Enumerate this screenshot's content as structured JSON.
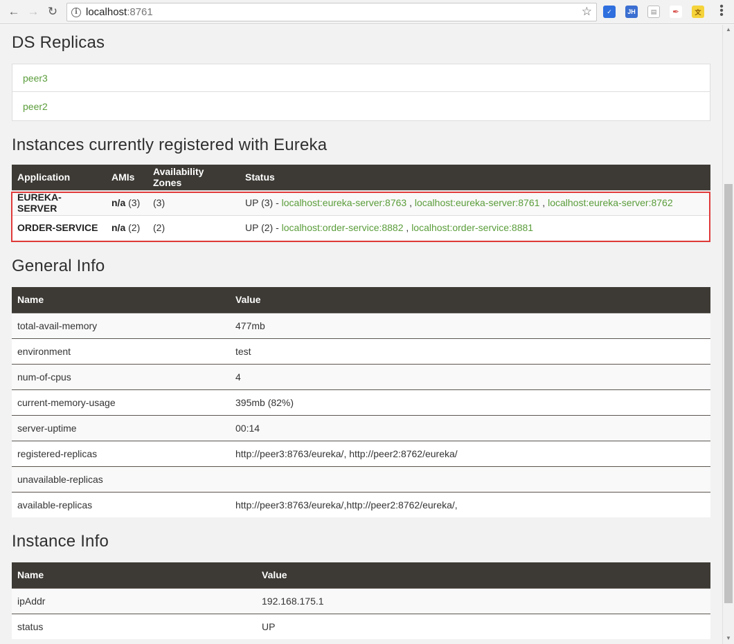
{
  "browser": {
    "url_host": "localhost",
    "url_port": ":8761",
    "extensions": [
      {
        "name": "pocket-icon",
        "label": "",
        "color": "#2f6fde"
      },
      {
        "name": "jh-icon",
        "label": "JH",
        "color": "#3b6fd1"
      },
      {
        "name": "page-icon",
        "label": "",
        "color": "#b0b0b0"
      },
      {
        "name": "pen-icon",
        "label": "",
        "color": "#d9534f"
      },
      {
        "name": "translate-icon",
        "label": "",
        "color": "#e6b800"
      }
    ]
  },
  "ds_replicas": {
    "title": "DS Replicas",
    "items": [
      "peer3",
      "peer2"
    ]
  },
  "instances": {
    "title": "Instances currently registered with Eureka",
    "headers": [
      "Application",
      "AMIs",
      "Availability Zones",
      "Status"
    ],
    "rows": [
      {
        "application": "EUREKA-SERVER",
        "amis_bold": "n/a",
        "amis_count": " (3)",
        "zones": "(3)",
        "status_prefix": "UP (3) - ",
        "links": [
          "localhost:eureka-server:8763",
          "localhost:eureka-server:8761",
          "localhost:eureka-server:8762"
        ]
      },
      {
        "application": "ORDER-SERVICE",
        "amis_bold": "n/a",
        "amis_count": " (2)",
        "zones": "(2)",
        "status_prefix": "UP (2) - ",
        "links": [
          "localhost:order-service:8882",
          "localhost:order-service:8881"
        ]
      }
    ]
  },
  "general_info": {
    "title": "General Info",
    "headers": [
      "Name",
      "Value"
    ],
    "rows": [
      {
        "name": "total-avail-memory",
        "value": "477mb"
      },
      {
        "name": "environment",
        "value": "test"
      },
      {
        "name": "num-of-cpus",
        "value": "4"
      },
      {
        "name": "current-memory-usage",
        "value": "395mb (82%)"
      },
      {
        "name": "server-uptime",
        "value": "00:14"
      },
      {
        "name": "registered-replicas",
        "value": "http://peer3:8763/eureka/, http://peer2:8762/eureka/"
      },
      {
        "name": "unavailable-replicas",
        "value": ""
      },
      {
        "name": "available-replicas",
        "value": "http://peer3:8763/eureka/,http://peer2:8762/eureka/,"
      }
    ]
  },
  "instance_info": {
    "title": "Instance Info",
    "headers": [
      "Name",
      "Value"
    ],
    "rows": [
      {
        "name": "ipAddr",
        "value": "192.168.175.1"
      },
      {
        "name": "status",
        "value": "UP"
      }
    ]
  }
}
